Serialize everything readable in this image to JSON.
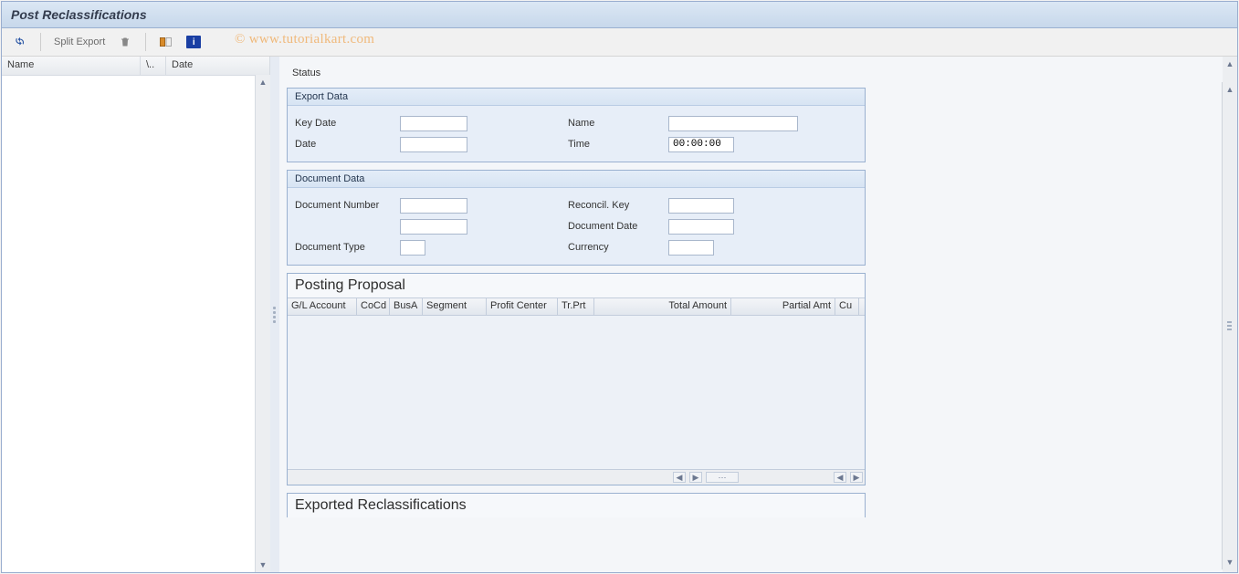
{
  "title": "Post Reclassifications",
  "watermark": "© www.tutorialkart.com",
  "toolbar": {
    "split_export": "Split Export"
  },
  "nav_columns": {
    "name": "Name",
    "a": "\\..",
    "date": "Date"
  },
  "status_label": "Status",
  "group_export": {
    "title": "Export Data",
    "fields": {
      "key_date_label": "Key Date",
      "key_date_value": "",
      "name_label": "Name",
      "name_value": "",
      "date_label": "Date",
      "date_value": "",
      "time_label": "Time",
      "time_value": "00:00:00"
    }
  },
  "group_doc": {
    "title": "Document Data",
    "fields": {
      "doc_number_label": "Document Number",
      "doc_number_value": "",
      "reconcil_key_label": "Reconcil. Key",
      "reconcil_key_value": "",
      "extra_value": "",
      "doc_date_label": "Document Date",
      "doc_date_value": "",
      "doc_type_label": "Document Type",
      "doc_type_value": "",
      "currency_label": "Currency",
      "currency_value": ""
    }
  },
  "grid_posting": {
    "title": "Posting Proposal",
    "columns": [
      "G/L Account",
      "CoCd",
      "BusA",
      "Segment",
      "Profit Center",
      "Tr.Prt",
      "Total Amount",
      "Partial Amt",
      "Cu"
    ]
  },
  "grid_exported": {
    "title": "Exported Reclassifications"
  }
}
